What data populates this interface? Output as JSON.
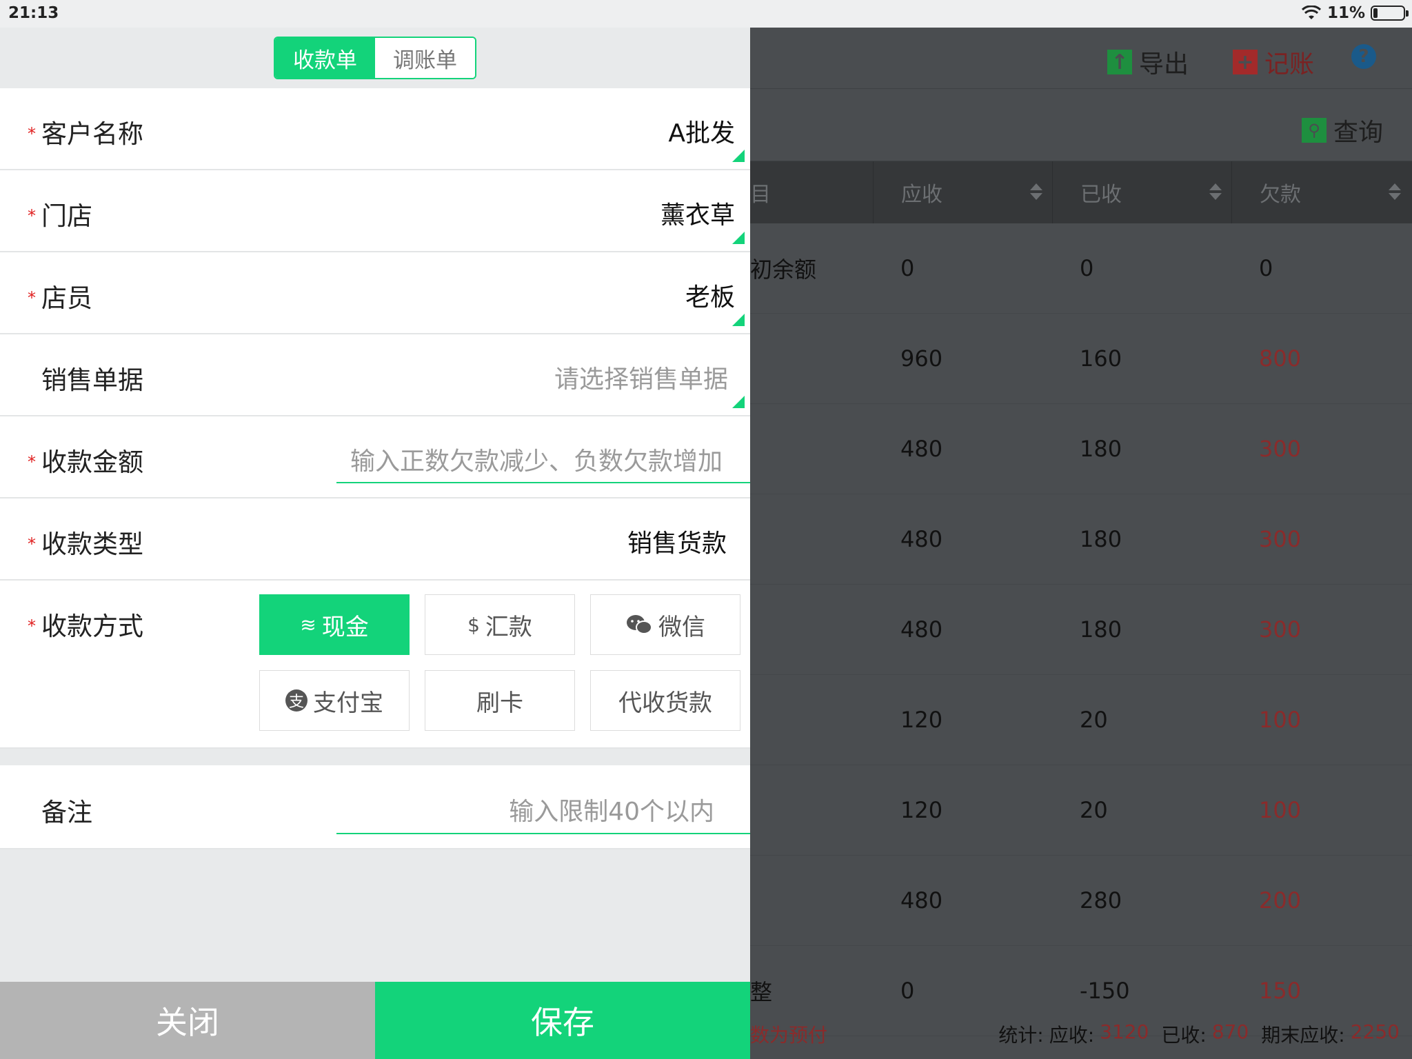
{
  "status_bar": {
    "time": "21:13",
    "battery": "11%"
  },
  "background": {
    "toolbar": {
      "export_label": "导出",
      "book_label": "记账",
      "help": "?"
    },
    "query_label": "查询",
    "columns": [
      "目",
      "应收",
      "已收",
      "欠款"
    ],
    "rows": [
      {
        "item": "初余额",
        "receivable": "0",
        "received": "0",
        "debt": "0"
      },
      {
        "item": "",
        "receivable": "960",
        "received": "160",
        "debt": "800"
      },
      {
        "item": "",
        "receivable": "480",
        "received": "180",
        "debt": "300"
      },
      {
        "item": "",
        "receivable": "480",
        "received": "180",
        "debt": "300"
      },
      {
        "item": "",
        "receivable": "480",
        "received": "180",
        "debt": "300"
      },
      {
        "item": "",
        "receivable": "120",
        "received": "20",
        "debt": "100"
      },
      {
        "item": "",
        "receivable": "120",
        "received": "20",
        "debt": "100"
      },
      {
        "item": "",
        "receivable": "480",
        "received": "280",
        "debt": "200"
      },
      {
        "item": "整",
        "receivable": "0",
        "received": "-150",
        "debt": "150"
      }
    ],
    "footer": {
      "note": "数为预付",
      "stats_prefix": "统计:",
      "receivable_label": "应收:",
      "receivable_value": "3120",
      "received_label": "已收:",
      "received_value": "870",
      "end_label": "期末应收:",
      "end_value": "2250"
    },
    "colors": {
      "red": "#8a2b2b",
      "export_icon": "#1e8f3f",
      "book_icon": "#a32a2a",
      "help_icon": "#1a5a8a"
    }
  },
  "segment": {
    "active": "收款单",
    "inactive": "调账单"
  },
  "form": {
    "required_mark": "*",
    "customer": {
      "label": "客户名称",
      "value": "A批发"
    },
    "store": {
      "label": "门店",
      "value": "薰衣草"
    },
    "clerk": {
      "label": "店员",
      "value": "老板"
    },
    "sales_doc": {
      "label": "销售单据",
      "placeholder": "请选择销售单据"
    },
    "amount": {
      "label": "收款金额",
      "placeholder": "输入正数欠款减少、负数欠款增加"
    },
    "type": {
      "label": "收款类型",
      "value": "销售货款"
    },
    "method": {
      "label": "收款方式",
      "options": [
        {
          "label": "现金",
          "icon": "coins-icon",
          "selected": true
        },
        {
          "label": "汇款",
          "icon": "remittance-icon",
          "selected": false
        },
        {
          "label": "微信",
          "icon": "wechat-icon",
          "selected": false
        },
        {
          "label": "支付宝",
          "icon": "alipay-icon",
          "selected": false
        },
        {
          "label": "刷卡",
          "icon": "",
          "selected": false
        },
        {
          "label": "代收货款",
          "icon": "",
          "selected": false
        }
      ]
    },
    "remark": {
      "label": "备注",
      "placeholder": "输入限制40个以内"
    }
  },
  "buttons": {
    "close": "关闭",
    "save": "保存"
  },
  "accent_color": "#13d37a"
}
